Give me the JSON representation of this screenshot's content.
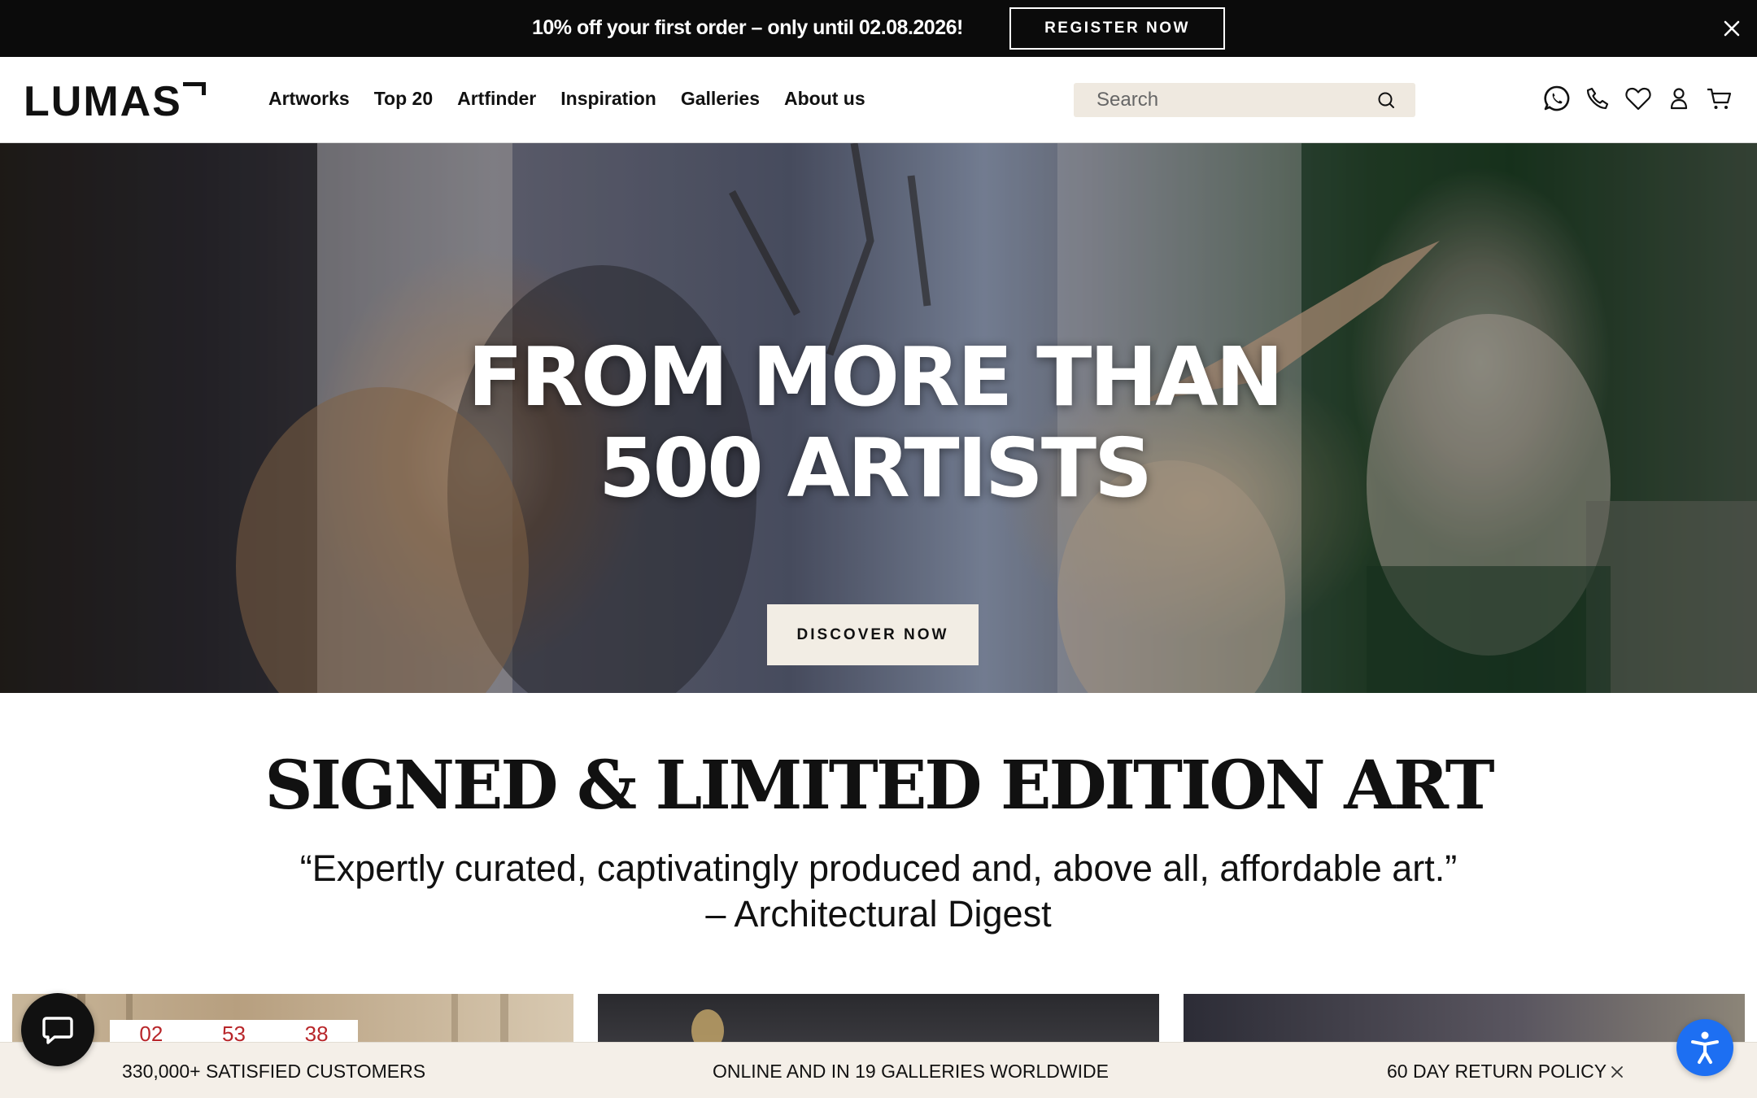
{
  "promo": {
    "text": "10% off your first order – only until 02.08.2026!",
    "button_label": "REGISTER NOW",
    "close_icon": "close-icon"
  },
  "header": {
    "logo": "LUMAS",
    "nav": [
      "Artworks",
      "Top 20",
      "Artfinder",
      "Inspiration",
      "Galleries",
      "About us"
    ],
    "search_placeholder": "Search",
    "icons": [
      "whatsapp-icon",
      "phone-icon",
      "heart-icon",
      "user-icon",
      "cart-icon"
    ]
  },
  "hero": {
    "title_line1": "FROM MORE THAN",
    "title_line2": "500 ARTISTS",
    "button_label": "DISCOVER NOW"
  },
  "intro": {
    "title": "SIGNED & LIMITED EDITION ART",
    "quote": "“Expertly curated, captivatingly produced and, above all, affordable art.”",
    "attribution": "– Architectural Digest"
  },
  "cards": {
    "countdown": [
      "02",
      "53",
      "38"
    ]
  },
  "trust_bar": {
    "items": [
      "330,000+ SATISFIED CUSTOMERS",
      "ONLINE AND IN 19 GALLERIES WORLDWIDE",
      "60 DAY RETURN POLICY"
    ]
  },
  "colors": {
    "promo_bg": "#0b0b0b",
    "search_bg": "#efe9e0",
    "trust_bg": "#f4efe8",
    "countdown_red": "#b8262a",
    "accessibility_blue": "#1d6ff2"
  }
}
